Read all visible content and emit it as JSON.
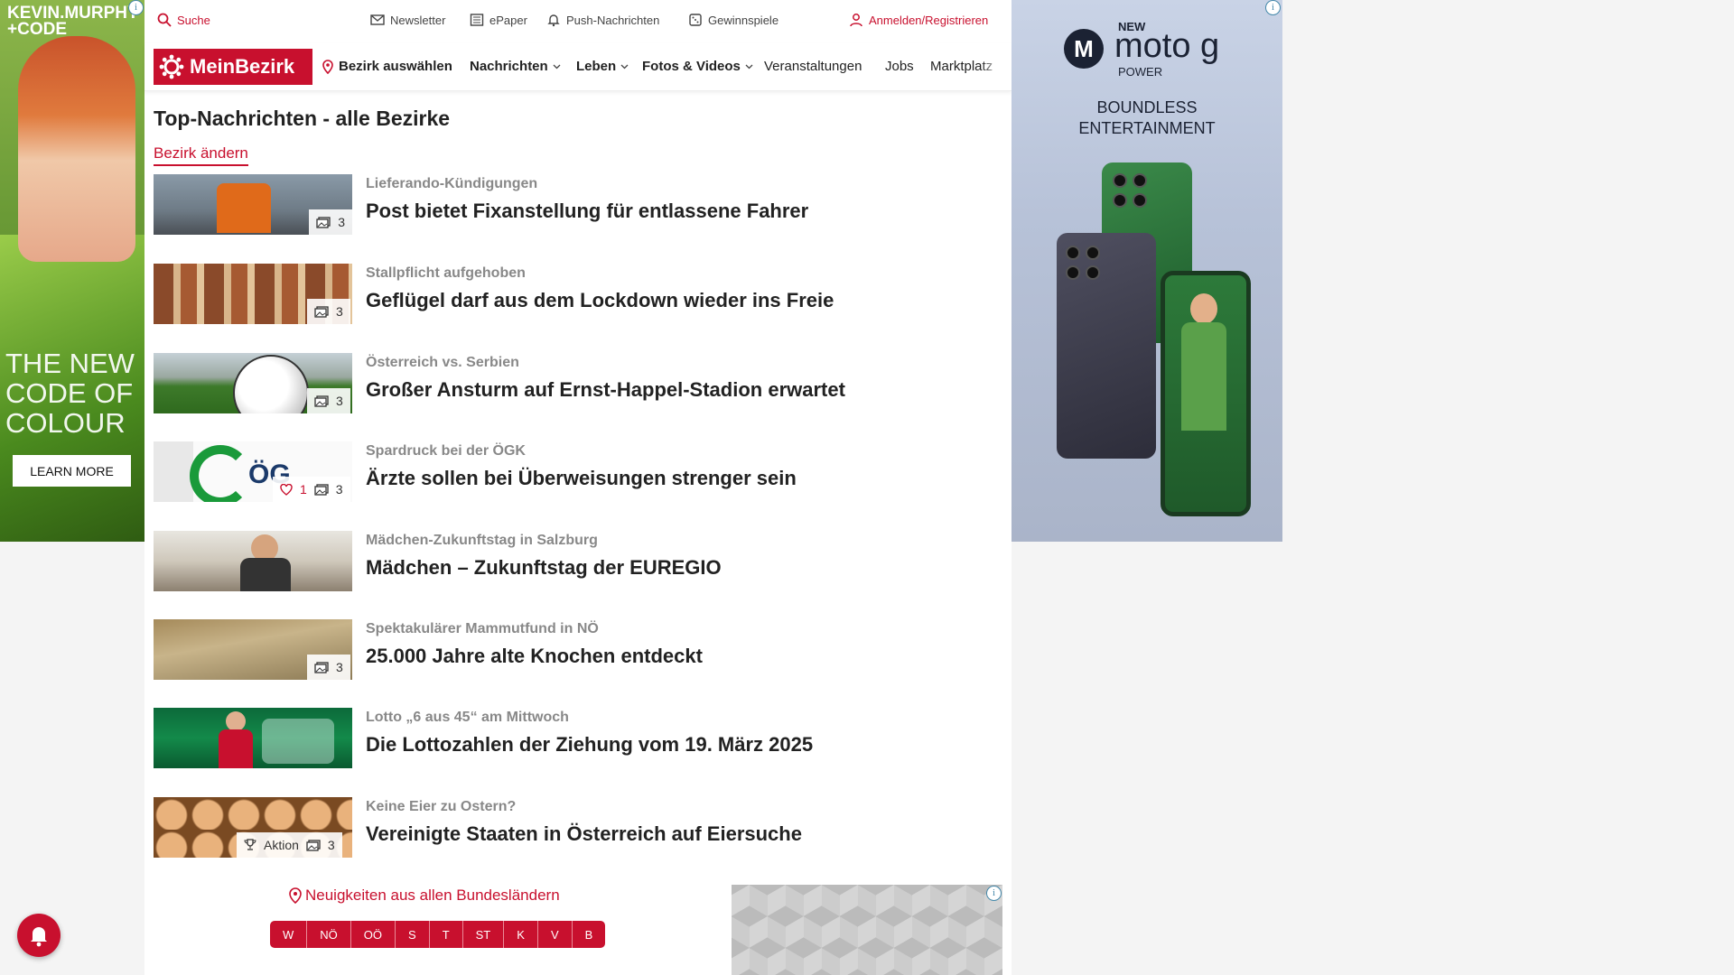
{
  "left_ad": {
    "brand": "KEVIN.MURPHY\n+CODE",
    "tagline": "THE NEW\nCODE OF\nCOLOUR",
    "cta": "LEARN MORE"
  },
  "topbar": {
    "search": "Suche",
    "newsletter": "Newsletter",
    "epaper": "ePaper",
    "push": "Push-Nachrichten",
    "gewinnspiele": "Gewinnspiele",
    "login": "Anmelden/Registrieren"
  },
  "nav": {
    "logo": "MeinBezirk",
    "bezirk": "Bezirk auswählen",
    "items": [
      "Nachrichten",
      "Leben",
      "Fotos & Videos",
      "Veranstaltungen",
      "Jobs",
      "Marktplatz"
    ]
  },
  "page": {
    "title": "Top-Nachrichten - alle Bezirke",
    "change_link": "Bezirk ändern"
  },
  "articles": [
    {
      "kicker": "Lieferando-Kündigungen",
      "headline": "Post bietet Fixanstellung für entlassene Fahrer",
      "photos": "3"
    },
    {
      "kicker": "Stallpflicht aufgehoben",
      "headline": "Geflügel darf aus dem Lockdown wieder ins Freie",
      "photos": "3"
    },
    {
      "kicker": "Österreich vs. Serbien",
      "headline": "Großer Ansturm auf Ernst-Happel-Stadion erwartet",
      "photos": "3"
    },
    {
      "kicker": "Spardruck bei der ÖGK",
      "headline": "Ärzte sollen bei Überweisungen strenger sein",
      "photos": "3",
      "likes": "1"
    },
    {
      "kicker": "Mädchen-Zukunftstag in Salzburg",
      "headline": "Mädchen – Zukunftstag der EUREGIO"
    },
    {
      "kicker": "Spektakulärer Mammutfund in NÖ",
      "headline": "25.000 Jahre alte Knochen entdeckt",
      "photos": "3"
    },
    {
      "kicker": "Lotto „6 aus 45“ am Mittwoch",
      "headline": "Die Lottozahlen der Ziehung vom 19. März 2025"
    },
    {
      "kicker": "Keine Eier zu Ostern?",
      "headline": "Vereinigte Staaten in Österreich auf Eiersuche",
      "photos": "3",
      "badge": "Aktion"
    }
  ],
  "footer": {
    "bundes_link": "Neuigkeiten aus allen Bundesländern",
    "states": [
      "W",
      "NÖ",
      "OÖ",
      "S",
      "T",
      "ST",
      "K",
      "V",
      "B"
    ]
  },
  "right_ad": {
    "new": "NEW",
    "product": "moto g",
    "power": "POWER",
    "slogan": "BOUNDLESS\nENTERTAINMENT",
    "logo_letter": "M"
  },
  "colors": {
    "accent": "#c8102e"
  }
}
